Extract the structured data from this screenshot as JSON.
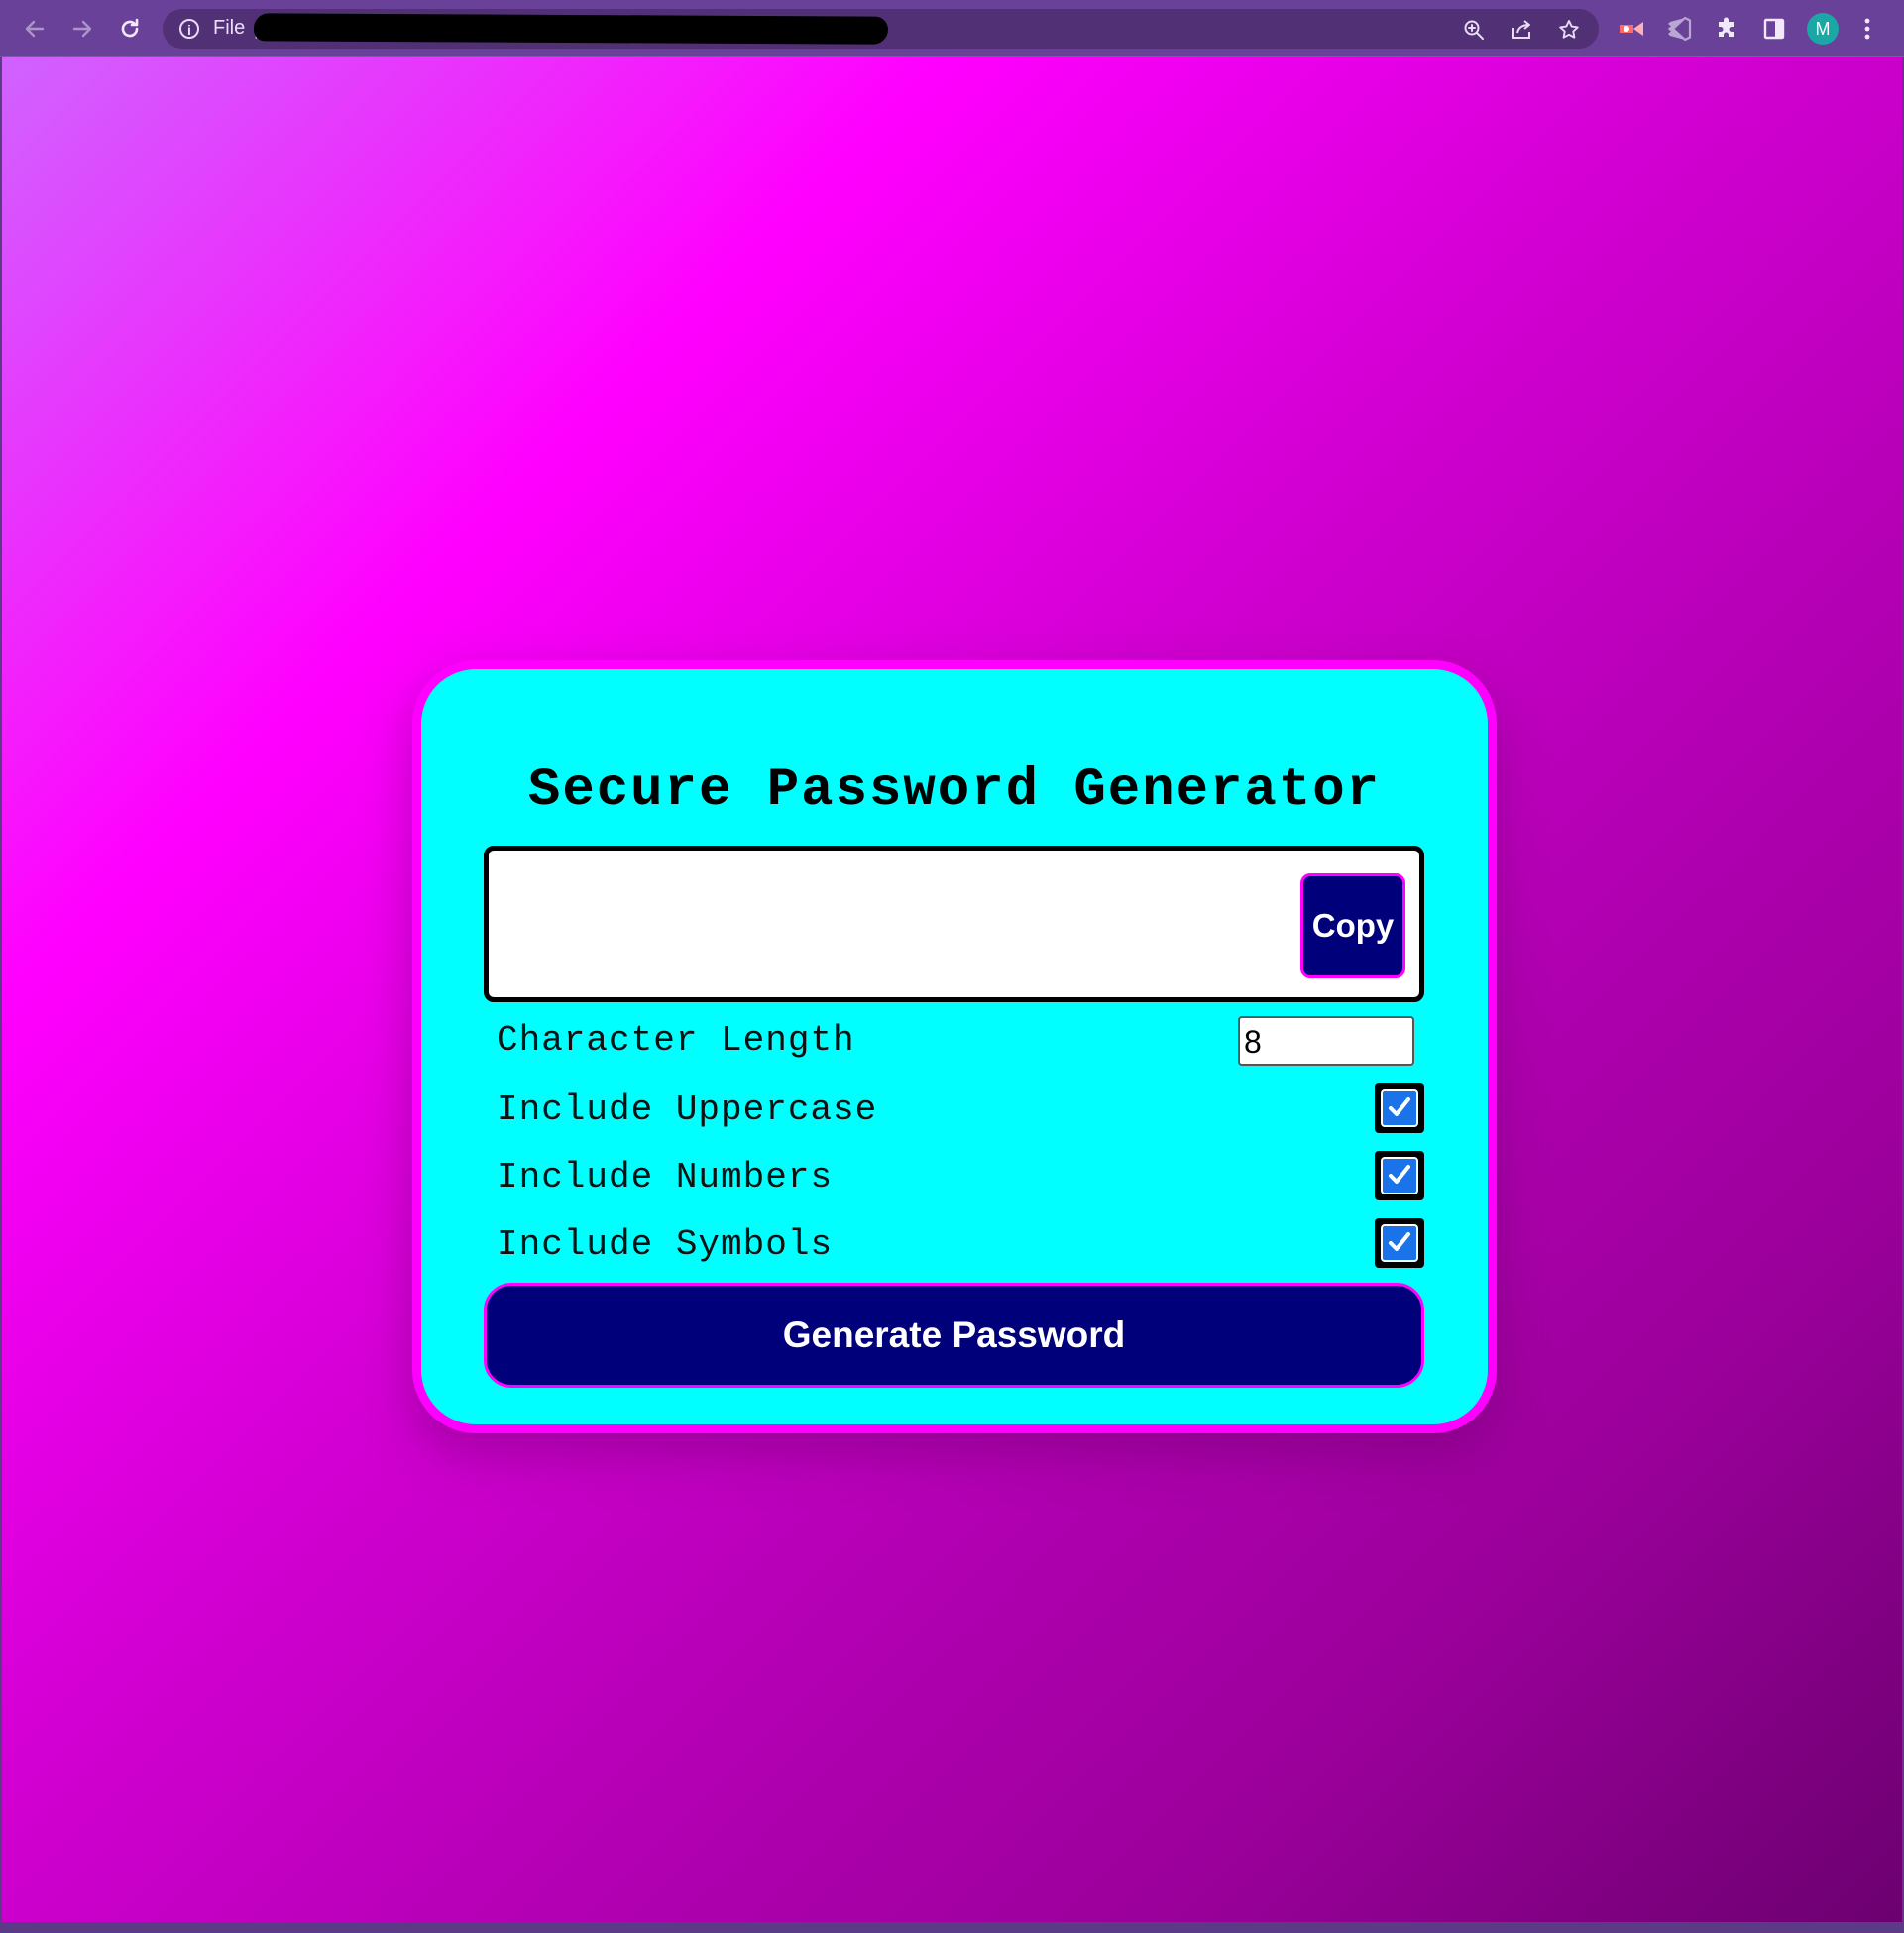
{
  "browser": {
    "url_scheme": "File",
    "url_separator": "|",
    "avatar_initial": "M",
    "theme_color": "#6a4199"
  },
  "app": {
    "title": "Secure Password Generator",
    "password_output": "",
    "copy_label": "Copy",
    "options": [
      {
        "label": "Character Length",
        "type": "number",
        "value": "8"
      },
      {
        "label": "Include Uppercase",
        "type": "checkbox",
        "checked": true
      },
      {
        "label": "Include Numbers",
        "type": "checkbox",
        "checked": true
      },
      {
        "label": "Include Symbols",
        "type": "checkbox",
        "checked": true
      }
    ],
    "generate_label": "Generate Password"
  },
  "colors": {
    "card_background": "#00ffff",
    "card_border": "#ff00ff",
    "button_background": "#00007a",
    "page_gradient_start": "#d063ff",
    "page_gradient_end": "#6c0070"
  }
}
